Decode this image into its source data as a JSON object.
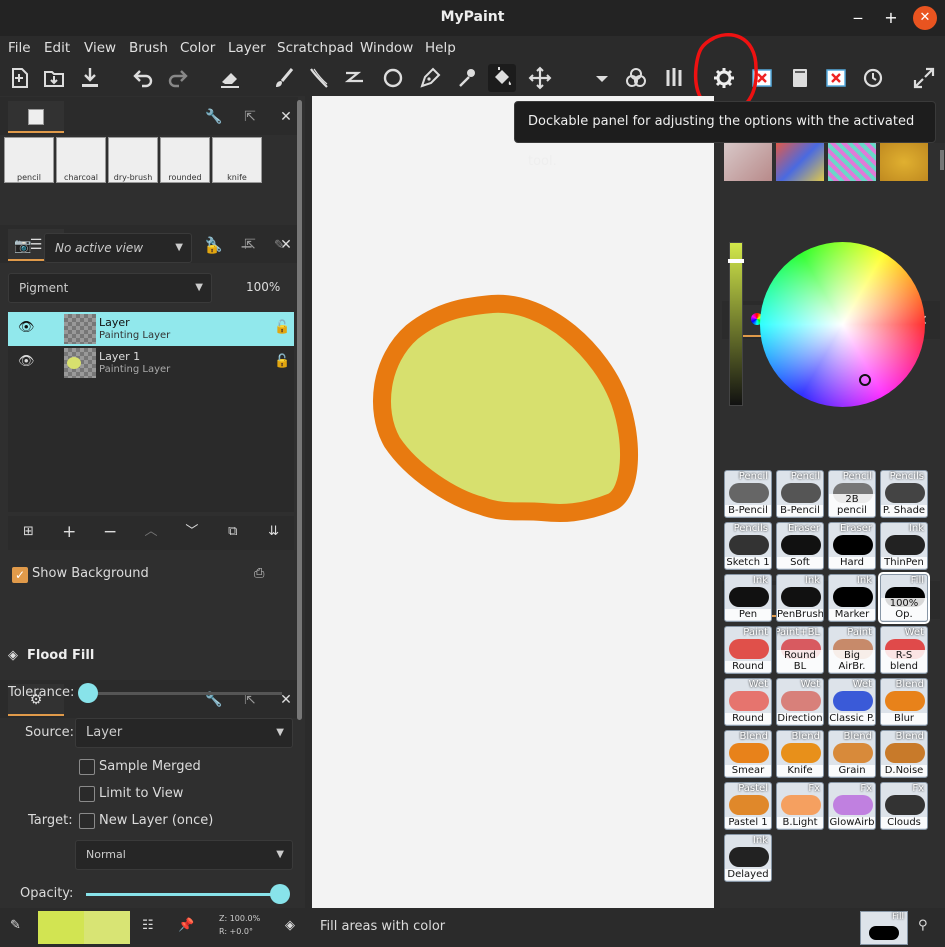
{
  "window": {
    "title": "MyPaint",
    "minimize": "‒",
    "maximize": "+",
    "close": "✕"
  },
  "menu": [
    "File",
    "Edit",
    "View",
    "Brush",
    "Color",
    "Layer",
    "Scratchpad",
    "Window",
    "Help"
  ],
  "tooltip": "Dockable panel for adjusting the options with the activated tool.",
  "brush_palette_top": [
    "pencil",
    "charcoal",
    "dry-brush",
    "rounded",
    "knife"
  ],
  "layers_panel": {
    "view_combo": "No active view",
    "mode_combo": "Pigment",
    "opacity": "100%",
    "layers": [
      {
        "name": "Layer",
        "type": "Painting Layer",
        "selected": true
      },
      {
        "name": "Layer 1",
        "type": "Painting Layer",
        "selected": false
      }
    ],
    "show_background_label": "Show Background"
  },
  "tool_options": {
    "title": "Flood Fill",
    "tolerance_label": "Tolerance:",
    "source_label": "Source:",
    "source_value": "Layer",
    "sample_merged": "Sample Merged",
    "limit_to_view": "Limit to View",
    "target_label": "Target:",
    "new_layer_once": "New Layer (once)",
    "blend_mode": "Normal",
    "opacity_label": "Opacity:"
  },
  "color_panel": {
    "value_accent": "#d2e84a"
  },
  "brushes": [
    {
      "group": "Pencil",
      "label": "B-Pencil",
      "art": "#666"
    },
    {
      "group": "Pencil",
      "label": "B-Pencil",
      "art": "#555"
    },
    {
      "group": "Pencil",
      "label": "2B pencil",
      "art": "#777"
    },
    {
      "group": "Pencils",
      "label": "P. Shade",
      "art": "#444"
    },
    {
      "group": "Pencils",
      "label": "Sketch 1",
      "art": "#333"
    },
    {
      "group": "Eraser",
      "label": "Soft",
      "art": "#111"
    },
    {
      "group": "Eraser",
      "label": "Hard",
      "art": "#000"
    },
    {
      "group": "Ink",
      "label": "ThinPen",
      "art": "#222"
    },
    {
      "group": "Ink",
      "label": "Pen",
      "art": "#111"
    },
    {
      "group": "Ink",
      "label": "PenBrush",
      "art": "#111"
    },
    {
      "group": "Ink",
      "label": "Marker",
      "art": "#000"
    },
    {
      "group": "Fill",
      "label": "100% Op.",
      "art": "#000"
    },
    {
      "group": "Paint",
      "label": "Round",
      "art": "#e0504a"
    },
    {
      "group": "Paint+BL",
      "label": "Round BL",
      "art": "#d85a60"
    },
    {
      "group": "Paint",
      "label": "Big AirBr.",
      "art": "#c78a6a"
    },
    {
      "group": "Wet",
      "label": "R-S blend",
      "art": "#e04a4a"
    },
    {
      "group": "Wet",
      "label": "Round",
      "art": "#e6746e"
    },
    {
      "group": "Wet",
      "label": "Direction",
      "art": "#d8807a"
    },
    {
      "group": "Wet",
      "label": "Classic P.",
      "art": "#3a5ad8"
    },
    {
      "group": "Blend",
      "label": "Blur",
      "art": "#e8821a"
    },
    {
      "group": "Blend",
      "label": "Smear",
      "art": "#e8821a"
    },
    {
      "group": "Blend",
      "label": "Knife",
      "art": "#e8901a"
    },
    {
      "group": "Blend",
      "label": "Grain",
      "art": "#d88a3a"
    },
    {
      "group": "Blend",
      "label": "D.Noise",
      "art": "#c87a2a"
    },
    {
      "group": "Pastel",
      "label": "Pastel 1",
      "art": "#e0882a"
    },
    {
      "group": "Fx",
      "label": "B.Light",
      "art": "#f5a060"
    },
    {
      "group": "Fx",
      "label": "GlowAirb",
      "art": "#c080e0"
    },
    {
      "group": "Fx",
      "label": "Clouds",
      "art": "#333"
    },
    {
      "group": "Ink",
      "label": "Delayed",
      "art": "#222"
    }
  ],
  "statusbar": {
    "zoom": "Z: 100.0%",
    "rotation": "R: +0.0°",
    "message": "Fill areas with color",
    "current_brush_group": "Fill"
  },
  "colors": {
    "accent": "#e09a4a",
    "selection": "#91e8ec",
    "fill_yellow": "#d7e06e",
    "stroke_orange": "#e87a10",
    "swatch_main": "#d2e452",
    "swatch_prev": "#d8e474"
  }
}
